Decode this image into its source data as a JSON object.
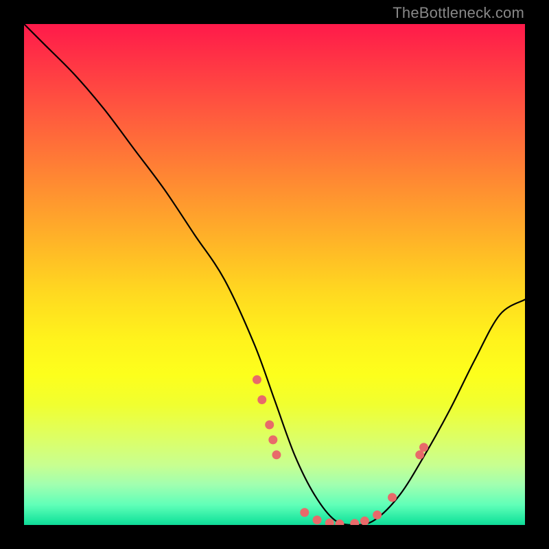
{
  "watermark": "TheBottleneck.com",
  "colors": {
    "dot": "#e86a6a",
    "curve": "#000000",
    "background_black": "#000000"
  },
  "chart_data": {
    "type": "line",
    "title": "",
    "xlabel": "",
    "ylabel": "",
    "xlim": [
      0,
      100
    ],
    "ylim": [
      0,
      100
    ],
    "note": "Axis values are in percent of plot width/height inferred from pixel positions; no numeric tick labels are shown in the image.",
    "series": [
      {
        "name": "bottleneck-curve",
        "x": [
          0,
          4,
          10,
          16,
          22,
          28,
          34,
          40,
          46,
          50,
          54,
          58,
          62,
          66,
          70,
          75,
          80,
          85,
          90,
          95,
          100
        ],
        "y": [
          100,
          96,
          90,
          83,
          75,
          67,
          58,
          49,
          36,
          25,
          14,
          6,
          1,
          0,
          1,
          6,
          14,
          23,
          33,
          42,
          45
        ]
      }
    ],
    "highlight_points": {
      "name": "sample-dots",
      "points": [
        {
          "x": 46.5,
          "y": 29
        },
        {
          "x": 47.5,
          "y": 25
        },
        {
          "x": 49.0,
          "y": 20
        },
        {
          "x": 49.7,
          "y": 17
        },
        {
          "x": 50.4,
          "y": 14
        },
        {
          "x": 56.0,
          "y": 2.5
        },
        {
          "x": 58.5,
          "y": 1.0
        },
        {
          "x": 61.0,
          "y": 0.4
        },
        {
          "x": 63.0,
          "y": 0.2
        },
        {
          "x": 66.0,
          "y": 0.3
        },
        {
          "x": 68.0,
          "y": 0.8
        },
        {
          "x": 70.5,
          "y": 2.0
        },
        {
          "x": 73.5,
          "y": 5.5
        },
        {
          "x": 79.0,
          "y": 14.0
        },
        {
          "x": 79.8,
          "y": 15.5
        }
      ]
    }
  }
}
